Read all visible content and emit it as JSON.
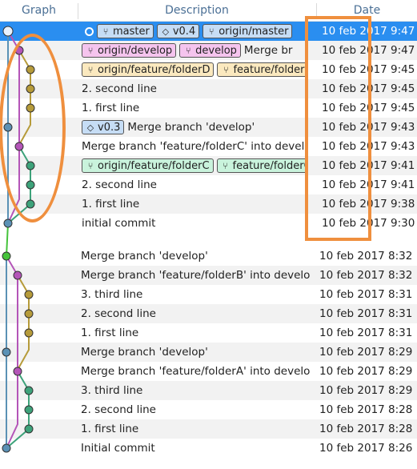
{
  "header": {
    "graph": "Graph",
    "description": "Description",
    "date": "Date"
  },
  "colors": {
    "selection": "#2a8ef0",
    "lane_blue": "#5b91b5",
    "lane_magenta": "#b455b8",
    "lane_olive": "#b69b3a",
    "lane_teal": "#3da27a",
    "lane_green": "#45c33b",
    "highlight_orange": "#ef8f3e"
  },
  "upper_rows": [
    {
      "badges": [
        {
          "kind": "master",
          "icon": "branch-icon",
          "text": "master"
        },
        {
          "kind": "tag",
          "icon": "tag-icon",
          "text": "v0.4"
        },
        {
          "kind": "master",
          "icon": "branch-icon",
          "text": "origin/master"
        }
      ],
      "local_head": true,
      "text": "",
      "date": "10 feb 2017 9:47",
      "selected": true
    },
    {
      "badges": [
        {
          "kind": "develop",
          "icon": "branch-icon",
          "text": "origin/develop"
        },
        {
          "kind": "develop",
          "icon": "branch-icon",
          "text": "develop"
        }
      ],
      "text": "Merge br",
      "date": "10 feb 2017 9:47"
    },
    {
      "badges": [
        {
          "kind": "folderd",
          "icon": "branch-icon",
          "text": "origin/feature/folderD"
        },
        {
          "kind": "folderd",
          "icon": "branch-icon",
          "text": "feature/folderD"
        }
      ],
      "text": "",
      "date": "10 feb 2017 9:45"
    },
    {
      "badges": [],
      "text": "2. second line",
      "date": "10 feb 2017 9:45"
    },
    {
      "badges": [],
      "text": "1. first line",
      "date": "10 feb 2017 9:45"
    },
    {
      "badges": [
        {
          "kind": "tag",
          "icon": "tag-icon",
          "text": "v0.3"
        }
      ],
      "text": "Merge branch 'develop'",
      "date": "10 feb 2017 9:43"
    },
    {
      "badges": [],
      "text": "Merge branch 'feature/folderC' into develo",
      "date": "10 feb 2017 9:43"
    },
    {
      "badges": [
        {
          "kind": "folderc",
          "icon": "branch-icon",
          "text": "origin/feature/folderC"
        },
        {
          "kind": "folderc",
          "icon": "branch-icon",
          "text": "feature/folderC"
        }
      ],
      "text": "",
      "date": "10 feb 2017 9:41"
    },
    {
      "badges": [],
      "text": "2. second line",
      "date": "10 feb 2017 9:41"
    },
    {
      "badges": [],
      "text": "1. first line",
      "date": "10 feb 2017 9:38"
    },
    {
      "badges": [],
      "text": "initial commit",
      "date": "10 feb 2017 9:30"
    }
  ],
  "lower_rows": [
    {
      "text": "Merge branch 'develop'",
      "date": "10 feb 2017 8:32"
    },
    {
      "text": "Merge branch 'feature/folderB' into develo",
      "date": "10 feb 2017 8:32"
    },
    {
      "text": "3. third line",
      "date": "10 feb 2017 8:31"
    },
    {
      "text": "2. second line",
      "date": "10 feb 2017 8:31"
    },
    {
      "text": "1. first line",
      "date": "10 feb 2017 8:31"
    },
    {
      "text": "Merge branch 'develop'",
      "date": "10 feb 2017 8:29"
    },
    {
      "text": "Merge branch 'feature/folderA' into develo",
      "date": "10 feb 2017 8:29"
    },
    {
      "text": "3. third line",
      "date": "10 feb 2017 8:29"
    },
    {
      "text": "2. second line",
      "date": "10 feb 2017 8:28"
    },
    {
      "text": "1. first line",
      "date": "10 feb 2017 8:28"
    },
    {
      "text": "Initial commit",
      "date": "10 feb 2017 8:26"
    }
  ]
}
